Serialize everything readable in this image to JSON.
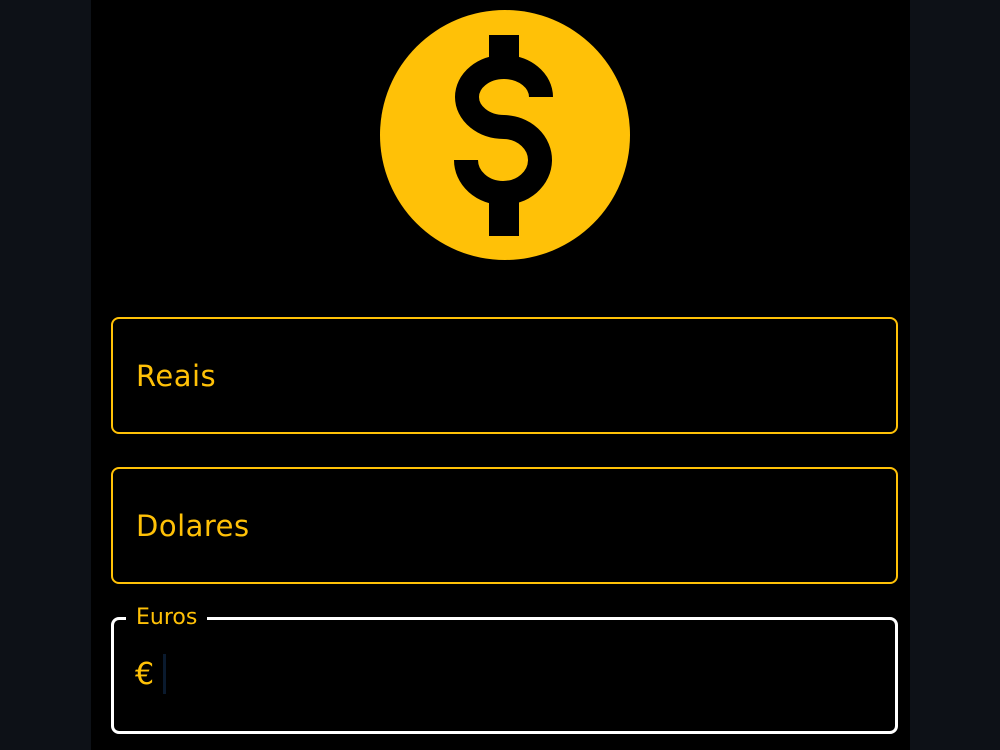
{
  "app": {
    "logo_icon": "dollar-coin-icon",
    "accent_color": "#ffc107",
    "background_color": "#000000"
  },
  "fields": {
    "reais": {
      "label": "Reais",
      "value": ""
    },
    "dolares": {
      "label": "Dolares",
      "value": ""
    },
    "euros": {
      "label": "Euros",
      "prefix": "€",
      "value": "",
      "focused": true
    }
  }
}
